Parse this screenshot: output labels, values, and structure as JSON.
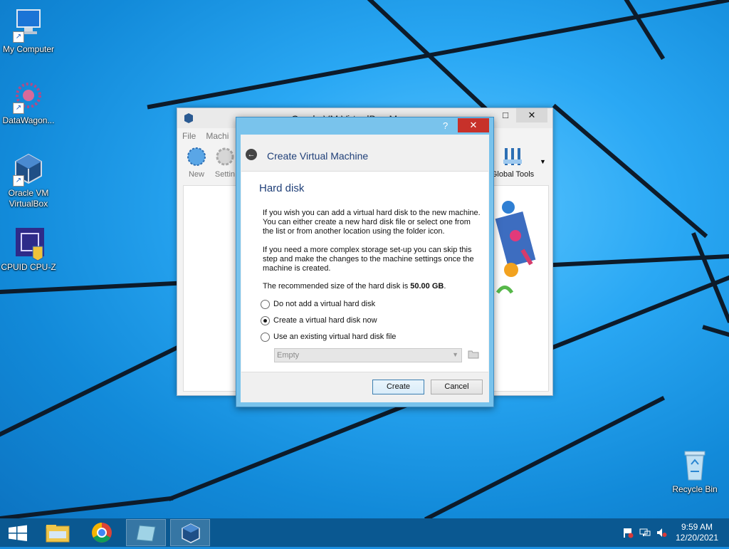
{
  "desktop": {
    "icons": [
      {
        "label": "My Computer",
        "icon": "computer-icon"
      },
      {
        "label": "DataWagon...",
        "icon": "datawagon-icon"
      },
      {
        "label": "Oracle VM VirtualBox",
        "icon": "virtualbox-icon"
      },
      {
        "label": "CPUID CPU-Z",
        "icon": "cpuz-icon"
      },
      {
        "label": "Recycle Bin",
        "icon": "recycle-bin-icon"
      }
    ]
  },
  "manager": {
    "title": "Oracle VM VirtualBox Manager",
    "menu": [
      "File",
      "Machi"
    ],
    "toolbar": {
      "new": "New",
      "settings": "Settin",
      "global_tools": "Global Tools"
    }
  },
  "dialog": {
    "help": "?",
    "close": "✕",
    "back": "←",
    "title": "Create Virtual Machine",
    "page_title": "Hard disk",
    "para1": "If you wish you can add a virtual hard disk to the new machine. You can either create a new hard disk file or select one from the list or from another location using the folder icon.",
    "para2": "If you need a more complex storage set-up you can skip this step and make the changes to the machine settings once the machine is created.",
    "para3_prefix": "The recommended size of the hard disk is ",
    "para3_size": "50.00 GB",
    "para3_suffix": ".",
    "options": [
      {
        "label": "Do not add a virtual hard disk",
        "selected": false
      },
      {
        "label": "Create a virtual hard disk now",
        "selected": true
      },
      {
        "label": "Use an existing virtual hard disk file",
        "selected": false
      }
    ],
    "combo_value": "Empty",
    "create_label": "Create",
    "cancel_label": "Cancel"
  },
  "taskbar": {
    "time": "9:59 AM",
    "date": "12/20/2021"
  },
  "colors": {
    "desktop": "#1a8ee0",
    "taskbar": "#0a5891",
    "dialog_frame": "#79c3ec",
    "close_button": "#c7312a",
    "heading": "#1f3f78"
  }
}
